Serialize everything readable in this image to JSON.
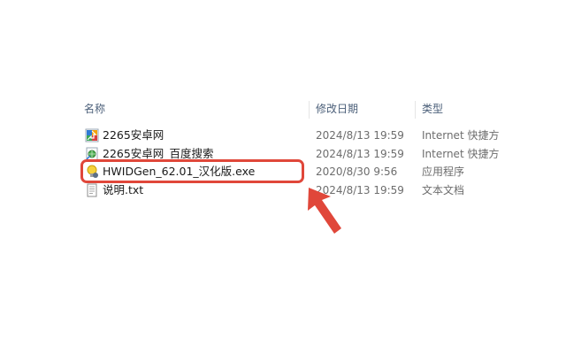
{
  "columns": {
    "name": "名称",
    "date": "修改日期",
    "type": "类型"
  },
  "files": [
    {
      "name": "2265安卓网",
      "date": "2024/8/13 19:59",
      "type": "Internet 快捷方",
      "icon": "internet-shortcut-icon"
    },
    {
      "name": "2265安卓网_百度搜索",
      "date": "2024/8/13 19:59",
      "type": "Internet 快捷方",
      "icon": "internet-shortcut-icon"
    },
    {
      "name": "HWIDGen_62.01_汉化版.exe",
      "date": "2020/8/30 9:56",
      "type": "应用程序",
      "icon": "application-icon"
    },
    {
      "name": "说明.txt",
      "date": "2024/8/13 19:59",
      "type": "文本文档",
      "icon": "text-document-icon"
    }
  ],
  "colors": {
    "highlight": "#e0473a",
    "header_text": "#4c607a",
    "meta_text": "#6d6d6d"
  }
}
